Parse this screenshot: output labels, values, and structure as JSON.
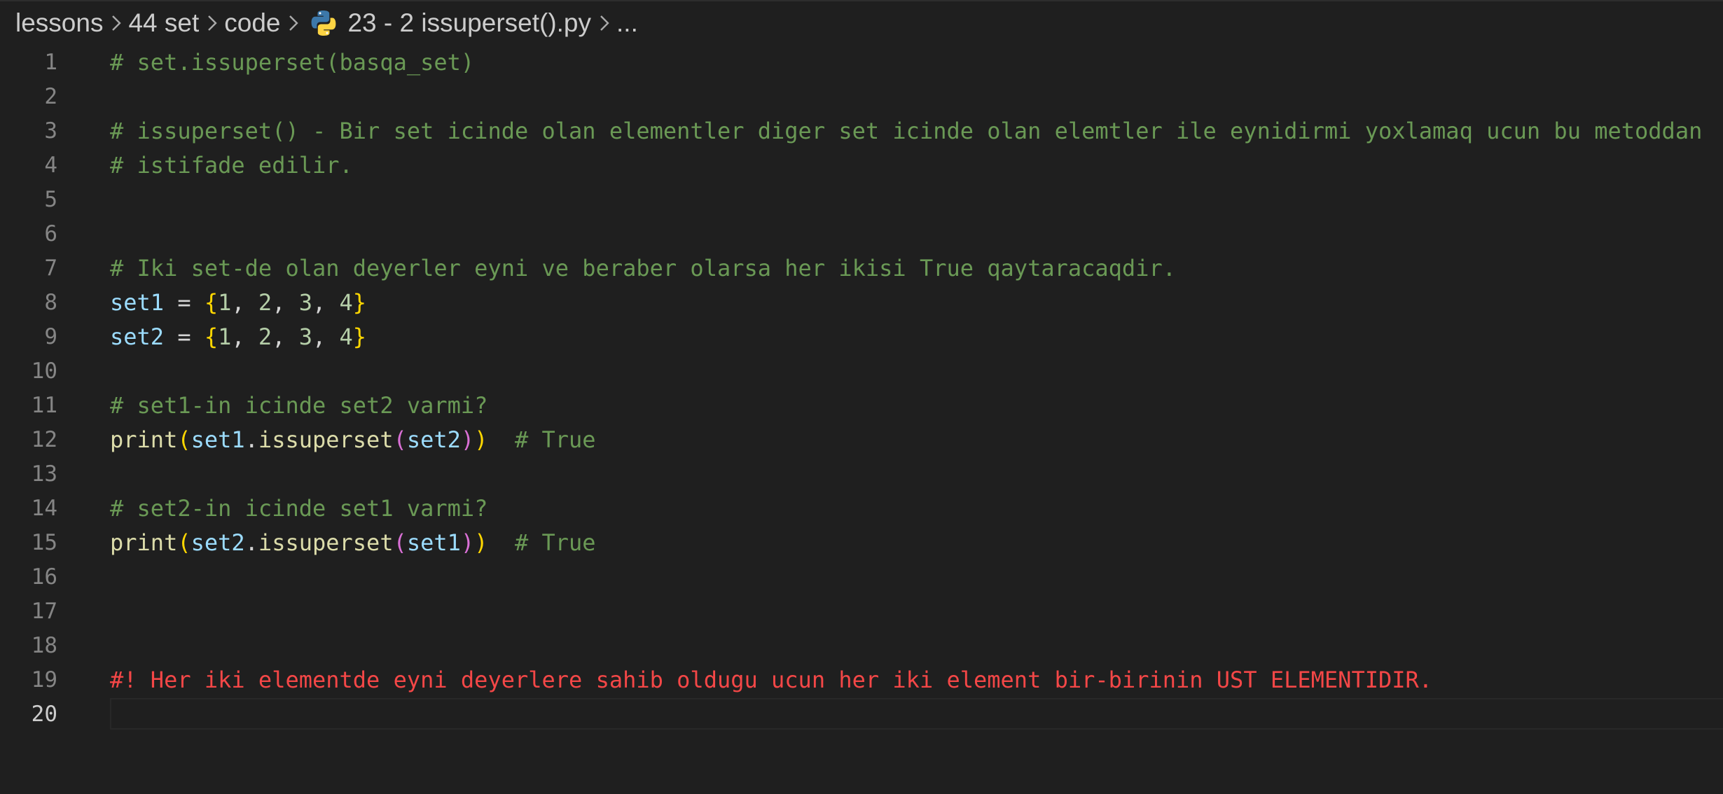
{
  "breadcrumb": {
    "items": [
      "lessons",
      "44 set",
      "code",
      "23 - 2 issuperset().py",
      "..."
    ],
    "file_icon": "python-icon"
  },
  "editor": {
    "active_line": 20,
    "colors": {
      "comment": "#6a9955",
      "alert_comment": "#f44747",
      "variable": "#9cdcfe",
      "function": "#dcdcaa",
      "number": "#b5cea8",
      "bracket_level1": "#ffd700",
      "bracket_level2": "#da70d6"
    },
    "lines": [
      {
        "n": "1",
        "t": "# set.issuperset(basqa_set)"
      },
      {
        "n": "2",
        "t": ""
      },
      {
        "n": "3",
        "t": "# issuperset() - Bir set icinde olan elementler diger set icinde olan elemtler ile eynidirmi yoxlamaq ucun bu metoddan"
      },
      {
        "n": "4",
        "t": "# istifade edilir."
      },
      {
        "n": "5",
        "t": ""
      },
      {
        "n": "6",
        "t": ""
      },
      {
        "n": "7",
        "t": "# Iki set-de olan deyerler eyni ve beraber olarsa her ikisi True qaytaracaqdir."
      },
      {
        "n": "8",
        "t": "set1 = {1, 2, 3, 4}"
      },
      {
        "n": "9",
        "t": "set2 = {1, 2, 3, 4}"
      },
      {
        "n": "10",
        "t": ""
      },
      {
        "n": "11",
        "t": "# set1-in icinde set2 varmi?"
      },
      {
        "n": "12",
        "t": "print(set1.issuperset(set2))  # True"
      },
      {
        "n": "13",
        "t": ""
      },
      {
        "n": "14",
        "t": "# set2-in icinde set1 varmi?"
      },
      {
        "n": "15",
        "t": "print(set2.issuperset(set1))  # True"
      },
      {
        "n": "16",
        "t": ""
      },
      {
        "n": "17",
        "t": ""
      },
      {
        "n": "18",
        "t": ""
      },
      {
        "n": "19",
        "t": "#! Her iki elementde eyni deyerlere sahib oldugu ucun her iki element bir-birinin UST ELEMENTIDIR."
      },
      {
        "n": "20",
        "t": ""
      }
    ]
  }
}
